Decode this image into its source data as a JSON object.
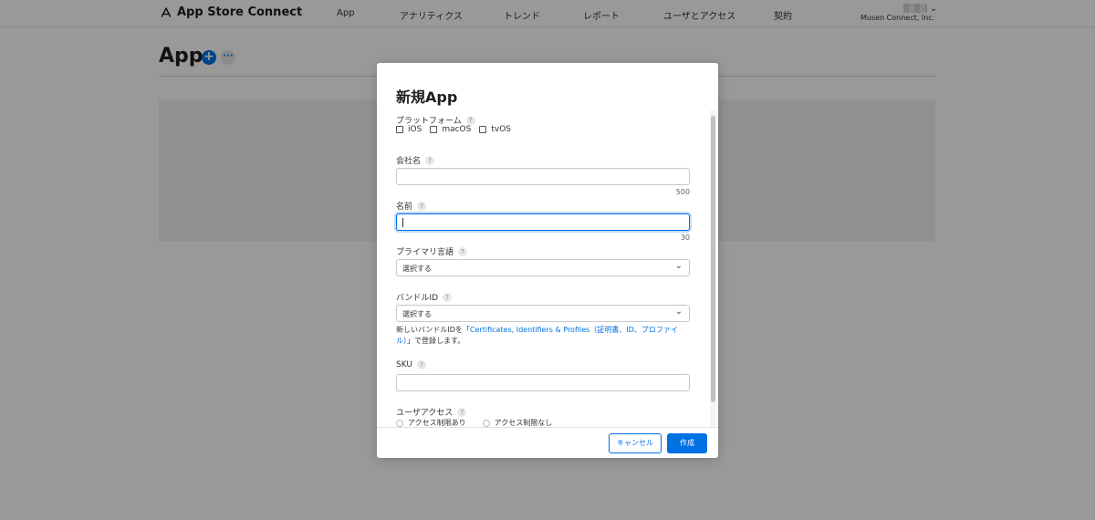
{
  "header": {
    "brand": "App Store Connect",
    "nav": [
      "App",
      "アナリティクス",
      "トレンド",
      "レポート",
      "ユーザとアクセス",
      "契約"
    ],
    "account_name": "Musen Connect, Inc."
  },
  "page": {
    "title": "App",
    "add_label": "+",
    "more_label": "···"
  },
  "modal": {
    "title": "新規App",
    "platform": {
      "label": "プラットフォーム",
      "options": [
        "iOS",
        "macOS",
        "tvOS"
      ]
    },
    "company": {
      "label": "会社名",
      "value": "",
      "limit": "500"
    },
    "name": {
      "label": "名前",
      "value": "",
      "limit": "30"
    },
    "primary_language": {
      "label": "プライマリ言語",
      "selected": "選択する"
    },
    "bundle_id": {
      "label": "バンドルID",
      "selected": "選択する",
      "help_prefix": "新しいバンドルIDを「",
      "help_link": "Certificates, Identifiers & Profiles（証明書、ID、プロファイル）",
      "help_suffix": "」で登録します。"
    },
    "sku": {
      "label": "SKU",
      "value": ""
    },
    "user_access": {
      "label": "ユーザアクセス",
      "options": [
        "アクセス制限あり",
        "アクセス制限なし"
      ]
    },
    "help_mark": "?",
    "cancel_label": "キャンセル",
    "create_label": "作成"
  },
  "colors": {
    "accent": "#0071e3",
    "overlay": "rgba(0,0,0,0.4)"
  }
}
